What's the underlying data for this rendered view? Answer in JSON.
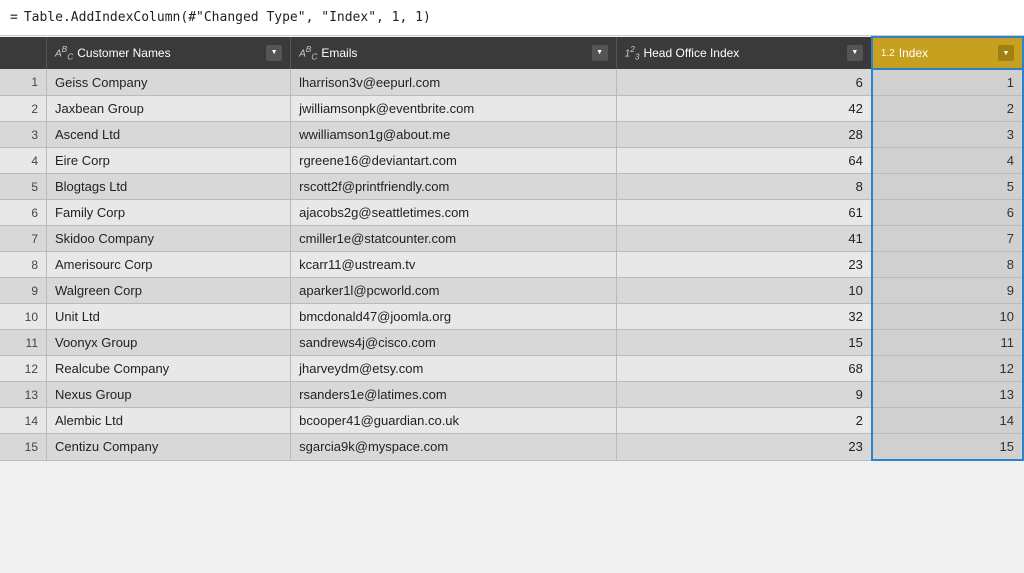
{
  "formula": {
    "equals": "=",
    "expression": "Table.AddIndexColumn(#\"Changed Type\", \"Index\", 1, 1)"
  },
  "columns": [
    {
      "id": "rownum",
      "label": "",
      "type": "",
      "class": "col-rownum"
    },
    {
      "id": "name",
      "label": "Customer Names",
      "type": "ABC",
      "class": "col-name"
    },
    {
      "id": "email",
      "label": "Emails",
      "type": "ABC",
      "class": "col-email"
    },
    {
      "id": "headoffice",
      "label": "Head Office Index",
      "type": "123",
      "class": "col-headoffice"
    },
    {
      "id": "index",
      "label": "Index",
      "type": "1.2",
      "class": "col-index",
      "highlighted": true
    }
  ],
  "rows": [
    {
      "num": 1,
      "name": "Geiss Company",
      "email": "lharrison3v@eepurl.com",
      "headoffice": "6",
      "index": 1
    },
    {
      "num": 2,
      "name": "Jaxbean Group",
      "email": "jwilliamsonpk@eventbrite.com",
      "headoffice": "42",
      "index": 2
    },
    {
      "num": 3,
      "name": "Ascend Ltd",
      "email": "wwilliamson1g@about.me",
      "headoffice": "28",
      "index": 3
    },
    {
      "num": 4,
      "name": "Eire Corp",
      "email": "rgreene16@deviantart.com",
      "headoffice": "64",
      "index": 4
    },
    {
      "num": 5,
      "name": "Blogtags Ltd",
      "email": "rscott2f@printfriendly.com",
      "headoffice": "8",
      "index": 5
    },
    {
      "num": 6,
      "name": "Family Corp",
      "email": "ajacobs2g@seattletimes.com",
      "headoffice": "61",
      "index": 6
    },
    {
      "num": 7,
      "name": "Skidoo Company",
      "email": "cmiller1e@statcounter.com",
      "headoffice": "41",
      "index": 7
    },
    {
      "num": 8,
      "name": "Amerisourc Corp",
      "email": "kcarr11@ustream.tv",
      "headoffice": "23",
      "index": 8
    },
    {
      "num": 9,
      "name": "Walgreen Corp",
      "email": "aparker1l@pcworld.com",
      "headoffice": "10",
      "index": 9
    },
    {
      "num": 10,
      "name": "Unit Ltd",
      "email": "bmcdonald47@joomla.org",
      "headoffice": "32",
      "index": 10
    },
    {
      "num": 11,
      "name": "Voonyx Group",
      "email": "sandrews4j@cisco.com",
      "headoffice": "15",
      "index": 11
    },
    {
      "num": 12,
      "name": "Realcube Company",
      "email": "jharveydm@etsy.com",
      "headoffice": "68",
      "index": 12
    },
    {
      "num": 13,
      "name": "Nexus Group",
      "email": "rsanders1e@latimes.com",
      "headoffice": "9",
      "index": 13
    },
    {
      "num": 14,
      "name": "Alembic Ltd",
      "email": "bcooper41@guardian.co.uk",
      "headoffice": "2",
      "index": 14
    },
    {
      "num": 15,
      "name": "Centizu Company",
      "email": "sgarcia9k@myspace.com",
      "headoffice": "23",
      "index": 15
    }
  ]
}
